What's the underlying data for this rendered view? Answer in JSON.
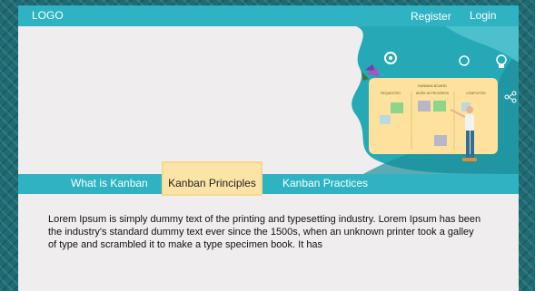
{
  "header": {
    "logo": "LOGO",
    "register_label": "Register",
    "login_label": "Login"
  },
  "illustration": {
    "board_title": "KANBAN BOARD",
    "columns": [
      "REQUESTED",
      "WORK IN PROGRESS",
      "COMPLETED"
    ]
  },
  "tabs": [
    {
      "label": "What is Kanban",
      "active": false
    },
    {
      "label": "Kanban Principles",
      "active": true
    },
    {
      "label": "Kanban Practices",
      "active": false
    }
  ],
  "content": {
    "text": "Lorem Ipsum is simply dummy text of the printing and typesetting industry. Lorem Ipsum has been the industry's standard dummy text ever since the 1500s, when an unknown printer took a galley of type and scrambled it to make a type specimen book. It has"
  },
  "colors": {
    "accent": "#2fb3c3",
    "active_tab": "#fce4a6",
    "page_background": "#efeded",
    "board": "#fde19c"
  }
}
